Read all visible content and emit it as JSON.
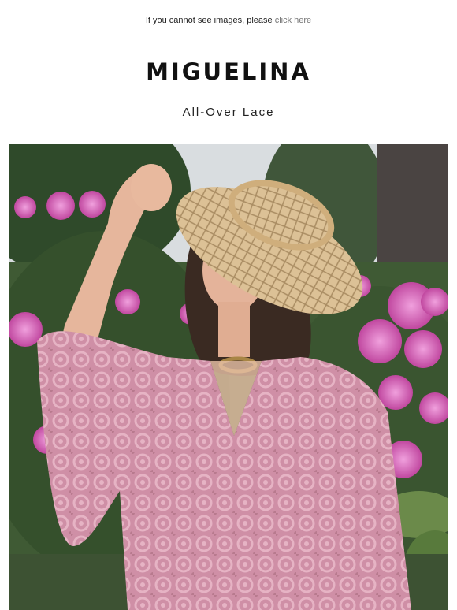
{
  "preheader": {
    "text": "If you cannot see images, please",
    "link_label": "click here"
  },
  "brand": {
    "logo": "MIGUELINA"
  },
  "headline": {
    "subtitle": "All-Over Lace"
  },
  "hero_image": {
    "description_icon": "hero-photo",
    "colors": {
      "sky": "#d9dde0",
      "foliage": "#3f5a34",
      "flowers": "#d561b8",
      "dress": "#cf8fa6",
      "hat": "#d9b98a",
      "wall": "#4a4442"
    }
  }
}
